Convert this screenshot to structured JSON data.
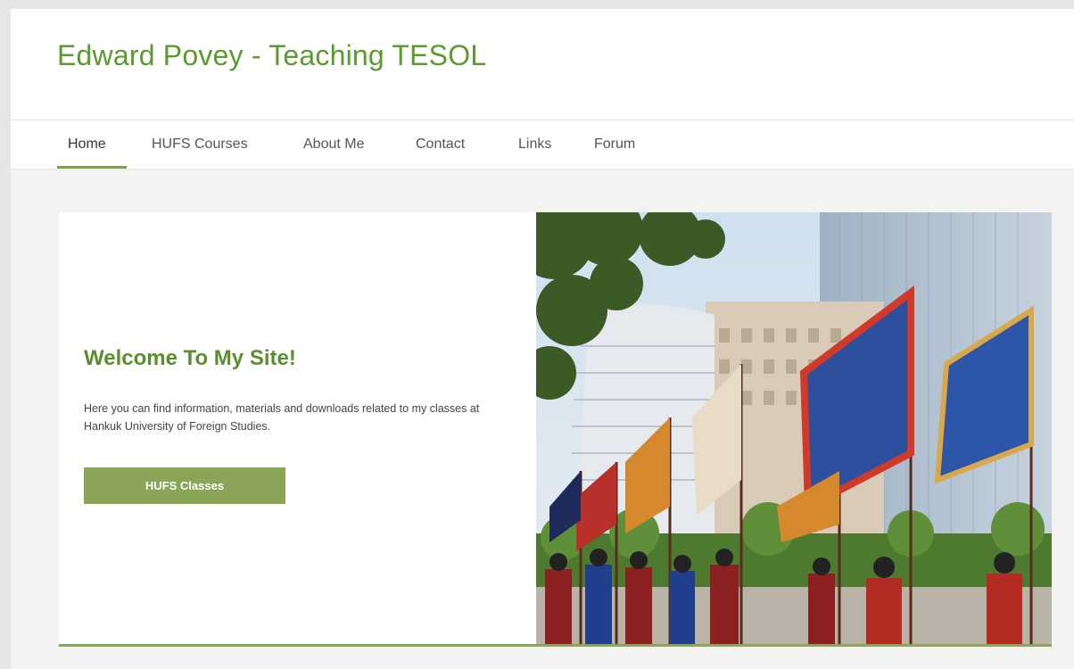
{
  "site": {
    "title": "Edward Povey - Teaching TESOL"
  },
  "nav": {
    "items": [
      {
        "label": "Home",
        "active": true
      },
      {
        "label": "HUFS Courses"
      },
      {
        "label": "About Me"
      },
      {
        "label": "Contact"
      },
      {
        "label": "Links"
      },
      {
        "label": "Forum"
      }
    ]
  },
  "hero": {
    "heading": "Welcome To My Site!",
    "body": "Here you can find information, materials and downloads related to my classes at Hankuk University of Foreign Studies.",
    "button_label": "HUFS Classes"
  },
  "colors": {
    "brand_green": "#5b9a2f",
    "button_green": "#8aa557",
    "page_bg": "#f3f3f2"
  }
}
